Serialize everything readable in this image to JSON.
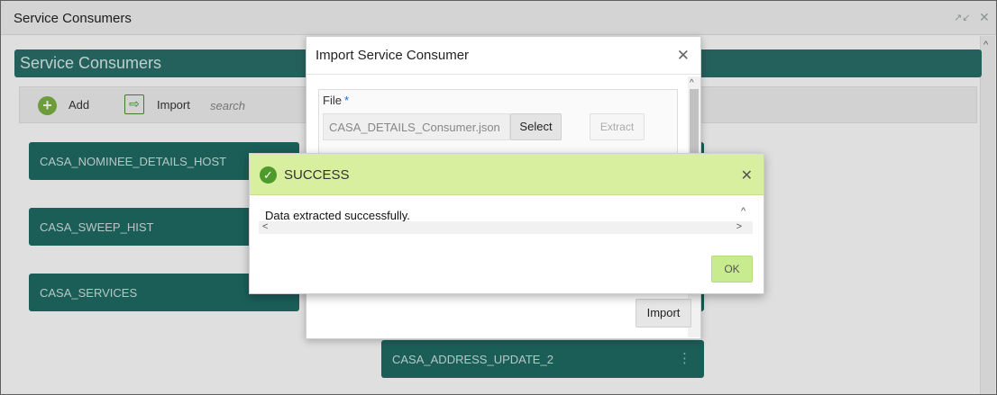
{
  "window": {
    "title": "Service Consumers"
  },
  "page": {
    "header": "Service Consumers"
  },
  "toolbar": {
    "add_label": "Add",
    "import_label": "Import",
    "search_placeholder": "search"
  },
  "tiles": [
    "CASA_NOMINEE_DETAILS_HOST",
    "CASA_SWEEP_HIST",
    "CASA_SERVICES",
    "CASA_ADDRESS_UPDATE_2"
  ],
  "import_dialog": {
    "title": "Import Service Consumer",
    "file_label": "File",
    "required_mark": "*",
    "file_name": "CASA_DETAILS_Consumer.json",
    "select_label": "Select",
    "extract_label": "Extract",
    "import_label": "Import"
  },
  "success_dialog": {
    "title": "SUCCESS",
    "message": "Data extracted successfully.",
    "ok_label": "OK"
  },
  "colors": {
    "teal_header": "#2b6f69",
    "tile": "#1f6b65",
    "success_header": "#d7ef9e",
    "ok_button": "#c9eb8f"
  }
}
